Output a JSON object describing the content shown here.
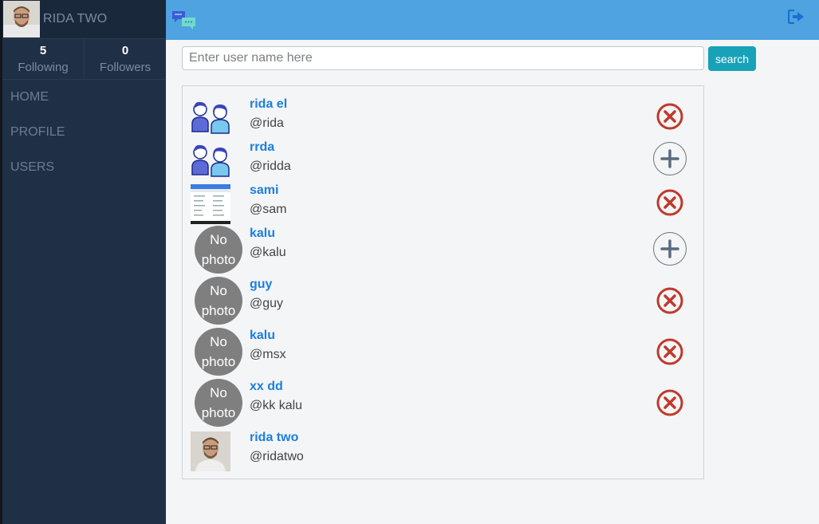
{
  "profile": {
    "name": "RIDA TWO",
    "following_count": "5",
    "following_label": "Following",
    "followers_count": "0",
    "followers_label": "Followers"
  },
  "nav": [
    {
      "label": "HOME"
    },
    {
      "label": "PROFILE"
    },
    {
      "label": "USERS"
    }
  ],
  "search": {
    "placeholder": "Enter user name here",
    "value": "",
    "button_label": "search"
  },
  "nophoto_label": {
    "line1": "No",
    "line2": "photo"
  },
  "users": [
    {
      "name": "rida el",
      "handle": "@rida",
      "photo": "people-icon",
      "action": "remove"
    },
    {
      "name": "rrda",
      "handle": "@ridda",
      "photo": "people-icon",
      "action": "add"
    },
    {
      "name": "sami",
      "handle": "@sam",
      "photo": "screenshot-thumbnail",
      "action": "remove"
    },
    {
      "name": "kalu",
      "handle": "@kalu",
      "photo": "none",
      "action": "add"
    },
    {
      "name": "guy",
      "handle": "@guy",
      "photo": "none",
      "action": "remove"
    },
    {
      "name": "kalu",
      "handle": "@msx",
      "photo": "none",
      "action": "remove"
    },
    {
      "name": "xx dd",
      "handle": "@kk kalu",
      "photo": "none",
      "action": "remove"
    },
    {
      "name": "rida two",
      "handle": "@ridatwo",
      "photo": "portrait",
      "action": "none"
    }
  ],
  "colors": {
    "sidebar": "#1f2f46",
    "topbar": "#4fa3e0",
    "search_button": "#17a2b8",
    "link": "#1b7fe0",
    "remove": "#c0392b"
  }
}
